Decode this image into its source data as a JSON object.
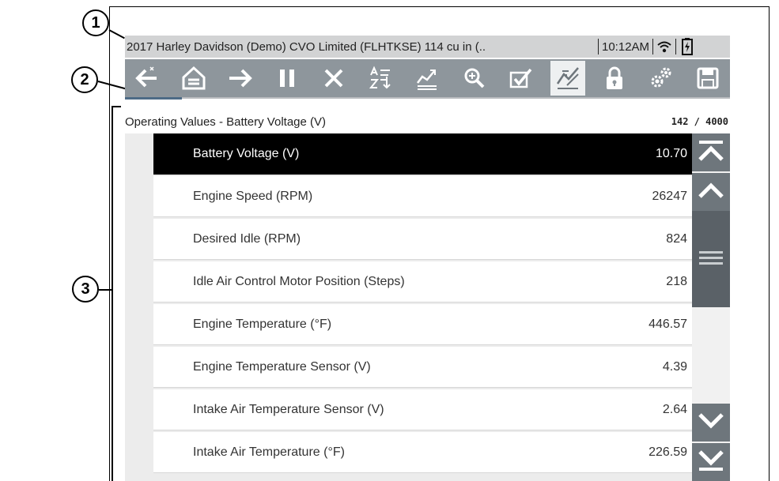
{
  "callouts": [
    "1",
    "2",
    "3"
  ],
  "status_bar": {
    "title": "2017 Harley Davidson (Demo) CVO Limited (FLHTKSE) 114 cu in (..",
    "time": "10:12AM",
    "wifi_icon": "wifi-icon",
    "battery_icon": "battery-icon"
  },
  "toolbar": {
    "buttons": [
      {
        "name": "back-button",
        "icon": "back-arrow-icon"
      },
      {
        "name": "home-button",
        "icon": "home-icon"
      },
      {
        "name": "forward-button",
        "icon": "forward-arrow-icon"
      },
      {
        "name": "pause-button",
        "icon": "pause-icon"
      },
      {
        "name": "clear-button",
        "icon": "close-icon"
      },
      {
        "name": "sort-button",
        "icon": "sort-az-icon"
      },
      {
        "name": "graph-button",
        "icon": "graph-icon"
      },
      {
        "name": "zoom-button",
        "icon": "zoom-in-icon"
      },
      {
        "name": "select-button",
        "icon": "checkmark-icon"
      },
      {
        "name": "custom-list-button",
        "icon": "custom-list-icon",
        "active": true
      },
      {
        "name": "lock-button",
        "icon": "lock-icon"
      },
      {
        "name": "settings-button",
        "icon": "gears-icon"
      },
      {
        "name": "save-button",
        "icon": "save-icon"
      }
    ]
  },
  "header": {
    "title": "Operating Values - Battery Voltage (V)",
    "counter": "142 / 4000"
  },
  "rows": [
    {
      "label": "Battery Voltage (V)",
      "value": "10.70",
      "selected": true
    },
    {
      "label": "Engine Speed (RPM)",
      "value": "26247"
    },
    {
      "label": "Desired Idle (RPM)",
      "value": "824"
    },
    {
      "label": "Idle Air Control Motor Position (Steps)",
      "value": "218"
    },
    {
      "label": "Engine Temperature (°F)",
      "value": "446.57"
    },
    {
      "label": "Engine Temperature Sensor (V)",
      "value": "4.39"
    },
    {
      "label": "Intake Air Temperature Sensor (V)",
      "value": "2.64"
    },
    {
      "label": "Intake Air Temperature (°F)",
      "value": "226.59"
    }
  ],
  "scrollbar": {
    "buttons": [
      "scroll-top-icon",
      "scroll-up-icon",
      "scroll-down-icon",
      "scroll-bottom-icon"
    ],
    "thumb_icon": "grip-lines-icon"
  },
  "colors": {
    "toolbar_bg": "#8e969c",
    "status_bg": "#d2d3d4",
    "selected_row_bg": "#000000",
    "scroll_button": "#6e767c"
  }
}
